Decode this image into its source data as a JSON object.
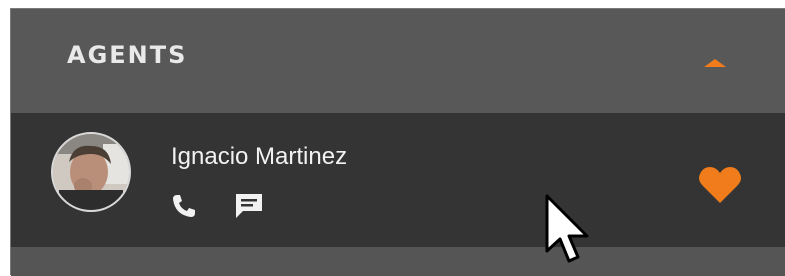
{
  "panel": {
    "title": "AGENTS",
    "accent_color": "#f07c1b",
    "collapse_icon": "caret-up-icon"
  },
  "agents": [
    {
      "name": "Ignacio Martinez",
      "avatar": "avatar-photo",
      "actions": {
        "call_icon": "phone-icon",
        "message_icon": "chat-icon",
        "favorite_icon": "heart-icon",
        "favorite": true
      }
    }
  ],
  "cursor_icon": "mouse-pointer-icon"
}
